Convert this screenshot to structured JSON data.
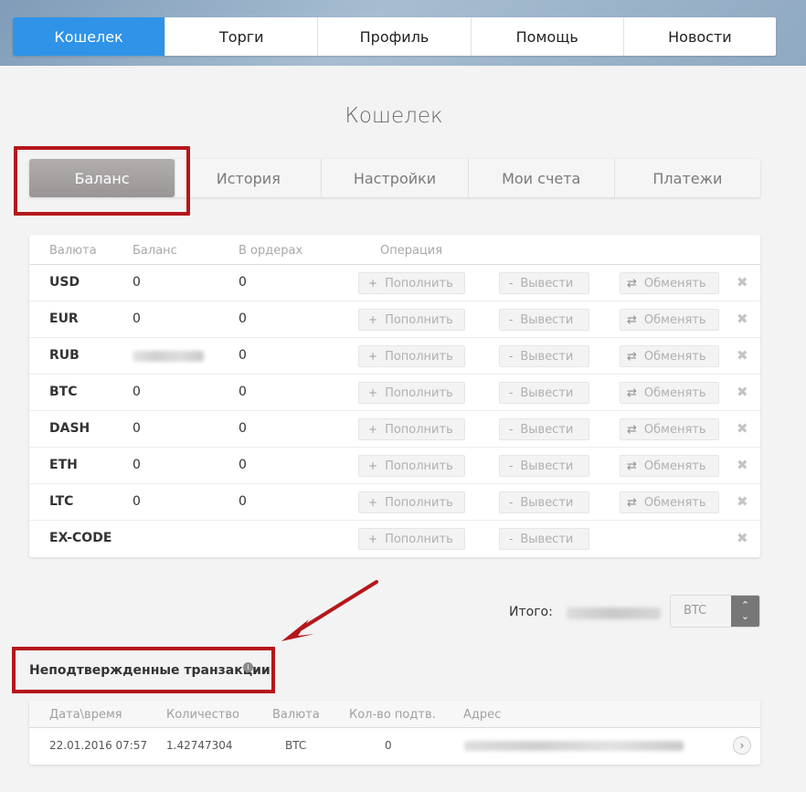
{
  "nav": {
    "items": [
      {
        "label": "Кошелек",
        "active": true
      },
      {
        "label": "Торги"
      },
      {
        "label": "Профиль"
      },
      {
        "label": "Помощь"
      },
      {
        "label": "Новости"
      }
    ]
  },
  "page": {
    "title": "Кошелек"
  },
  "subtabs": {
    "items": [
      {
        "label": "Баланс",
        "active": true
      },
      {
        "label": "История"
      },
      {
        "label": "Настройки"
      },
      {
        "label": "Мои счета"
      },
      {
        "label": "Платежи"
      }
    ]
  },
  "balance": {
    "headers": {
      "currency": "Валюта",
      "balance": "Баланс",
      "orders": "В ордерах",
      "operation": "Операция"
    },
    "buttons": {
      "deposit": "Пополнить",
      "withdraw": "Вывести",
      "exchange": "Обменять",
      "deposit_icon": "+",
      "withdraw_icon": "-",
      "exchange_icon": "⇄",
      "close_icon": "✖"
    },
    "rows": [
      {
        "currency": "USD",
        "balance": "0",
        "orders": "0"
      },
      {
        "currency": "EUR",
        "balance": "0",
        "orders": "0"
      },
      {
        "currency": "RUB",
        "balance": "",
        "orders": "0",
        "balance_blurred": true
      },
      {
        "currency": "BTC",
        "balance": "0",
        "orders": "0"
      },
      {
        "currency": "DASH",
        "balance": "0",
        "orders": "0"
      },
      {
        "currency": "ETH",
        "balance": "0",
        "orders": "0"
      },
      {
        "currency": "LTC",
        "balance": "0",
        "orders": "0"
      },
      {
        "currency": "EX-CODE",
        "balance": "",
        "orders": "",
        "no_exchange": true
      }
    ]
  },
  "total": {
    "label": "Итого:",
    "currency": "BTC",
    "up_icon": "⌃",
    "down_icon": "⌄"
  },
  "unconfirmed": {
    "title": "Неподтвержденные транзакции",
    "info_icon": "i",
    "headers": {
      "datetime": "Дата\\время",
      "amount": "Количество",
      "currency": "Валюта",
      "confirmations": "Кол-во подтв.",
      "address": "Адрес"
    },
    "rows": [
      {
        "datetime": "22.01.2016 07:57",
        "amount": "1.42747304",
        "currency": "BTC",
        "confirmations": "0",
        "go_icon": "›"
      }
    ]
  },
  "colors": {
    "accent": "#2f93e8",
    "highlight": "#b5161a"
  }
}
